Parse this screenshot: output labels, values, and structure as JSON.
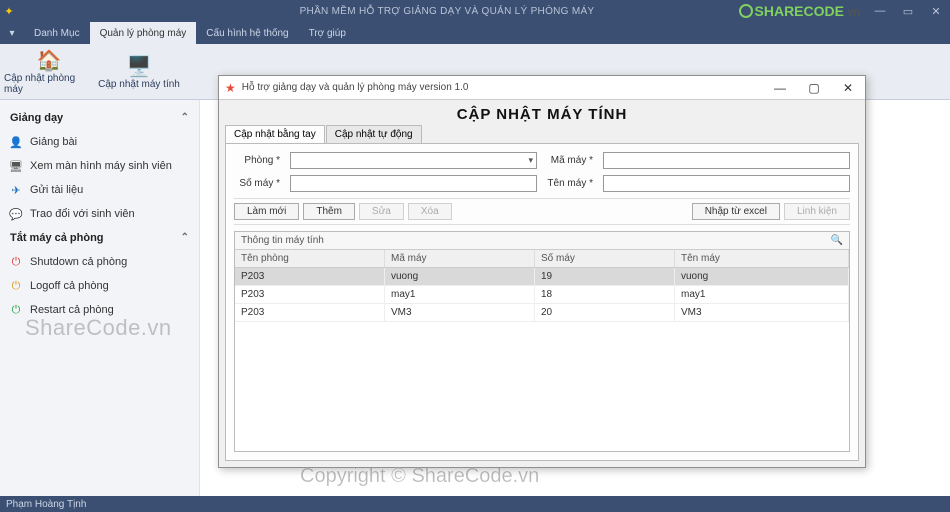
{
  "title": "PHẦN MỀM HỖ TRỢ GIẢNG DẠY VÀ QUẢN LÝ PHÒNG MÁY",
  "logo": {
    "brand": "SHARECODE",
    "suffix": ".vn"
  },
  "menubar": {
    "items": [
      "Danh Mục",
      "Quản lý phòng máy",
      "Cấu hình hệ thống",
      "Trợ giúp"
    ],
    "active_index": 1
  },
  "ribbon": {
    "btn1": "Cập nhật phòng máy",
    "btn2": "Cập nhật máy tính"
  },
  "sidebar": {
    "group1": {
      "title": "Giảng dạy",
      "items": [
        {
          "label": "Giảng bài",
          "icon": "person"
        },
        {
          "label": "Xem màn hình máy sinh viên",
          "icon": "monitor"
        },
        {
          "label": "Gửi tài liệu",
          "icon": "send"
        },
        {
          "label": "Trao đổi với sinh viên",
          "icon": "chat"
        }
      ]
    },
    "group2": {
      "title": "Tắt máy cả phòng",
      "items": [
        {
          "label": "Shutdown cả phòng",
          "icon": "power-red"
        },
        {
          "label": "Logoff cả phòng",
          "icon": "power-orange"
        },
        {
          "label": "Restart cả phòng",
          "icon": "power-green"
        }
      ]
    }
  },
  "statusbar": "Phạm Hoàng Tịnh",
  "dialog": {
    "title": "Hỗ trợ giảng dạy và quản lý phòng máy version 1.0",
    "heading": "CẬP NHẬT MÁY TÍNH",
    "tabs": [
      "Cập nhật bằng tay",
      "Cập nhật tự động"
    ],
    "active_tab": 0,
    "form": {
      "phong_label": "Phòng *",
      "phong_value": "",
      "somay_label": "Số máy *",
      "somay_value": "",
      "mamay_label": "Mã máy *",
      "mamay_value": "",
      "tenmay_label": "Tên máy *",
      "tenmay_value": ""
    },
    "buttons": {
      "lammoi": "Làm mới",
      "them": "Thêm",
      "sua": "Sửa",
      "xoa": "Xóa",
      "nhap_excel": "Nhập từ excel",
      "linhkien": "Linh kiện"
    },
    "grid": {
      "caption": "Thông tin máy tính",
      "columns": [
        "Tên phòng",
        "Mã máy",
        "Số máy",
        "Tên máy"
      ],
      "rows": [
        {
          "tenphong": "P203",
          "mamay": "vuong",
          "somay": "19",
          "tenmay": "vuong",
          "selected": true
        },
        {
          "tenphong": "P203",
          "mamay": "may1",
          "somay": "18",
          "tenmay": "may1",
          "selected": false
        },
        {
          "tenphong": "P203",
          "mamay": "VM3",
          "somay": "20",
          "tenmay": "VM3",
          "selected": false
        }
      ]
    }
  },
  "watermarks": {
    "wm1": "ShareCode.vn",
    "wm2": "Copyright © ShareCode.vn"
  }
}
